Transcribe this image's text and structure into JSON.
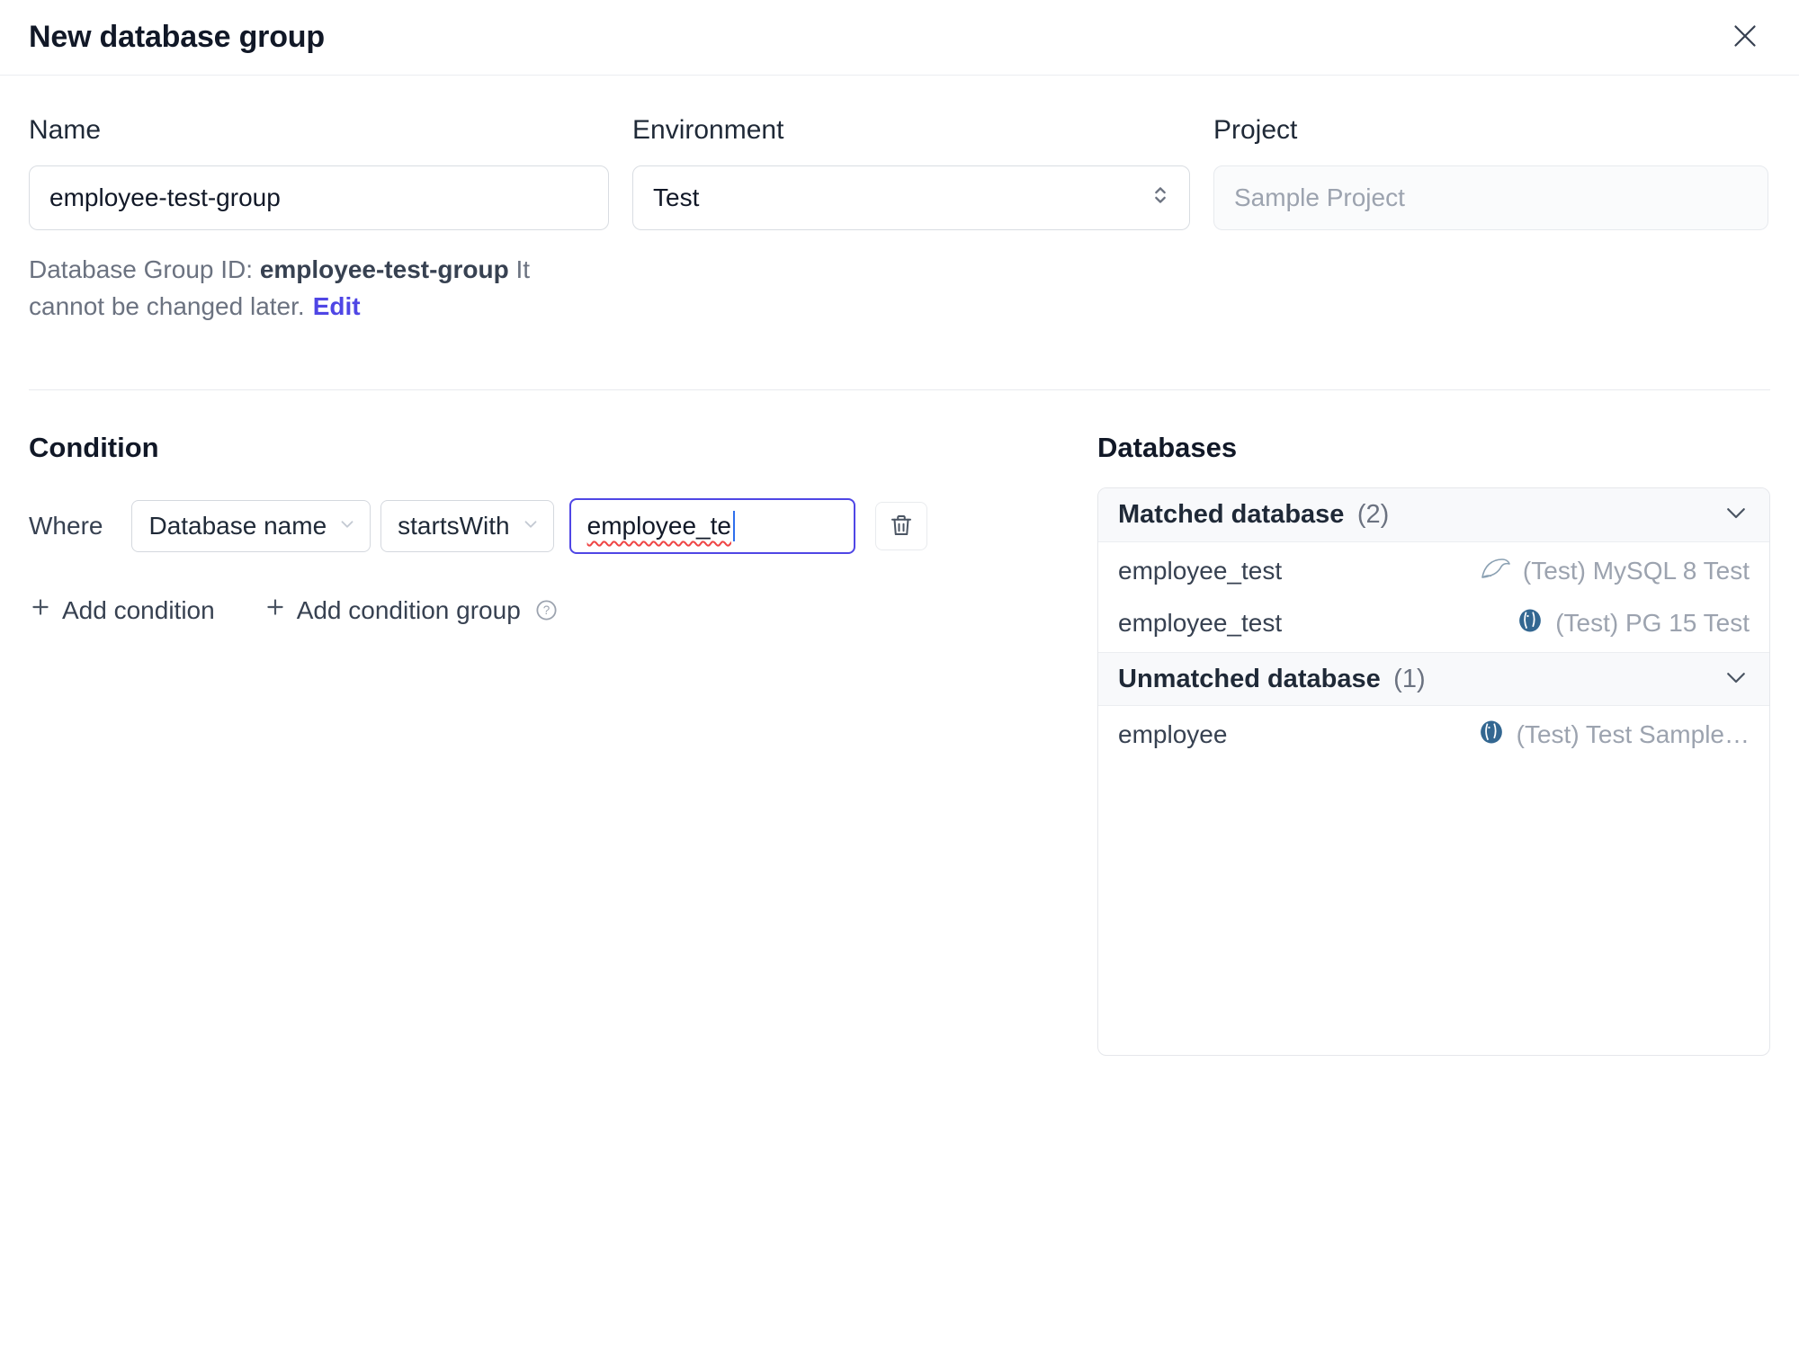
{
  "colors": {
    "accent": "#4f46e5",
    "link": "#4f46e5",
    "text": "#1f2937",
    "muted": "#6b7280",
    "faint": "#9ca3af",
    "border": "#e5e7eb",
    "spellcheck_red": "#ef4444",
    "postgres_blue": "#336791",
    "mysql_gray": "#8aa0b2"
  },
  "header": {
    "title": "New database group"
  },
  "form": {
    "name": {
      "label": "Name",
      "value": "employee-test-group"
    },
    "environment": {
      "label": "Environment",
      "value": "Test"
    },
    "project": {
      "label": "Project",
      "value": "Sample Project"
    },
    "group_id_note": {
      "prefix": "Database Group ID: ",
      "id": "employee-test-group",
      "suffix": " It cannot be changed later.",
      "edit_link": "Edit"
    }
  },
  "condition": {
    "heading": "Condition",
    "where_label": "Where",
    "field": "Database name",
    "operator": "startsWith",
    "value": "employee_te",
    "add_condition": "Add condition",
    "add_condition_group": "Add condition group"
  },
  "databases": {
    "heading": "Databases",
    "groups": [
      {
        "label": "Matched database",
        "count": "(2)",
        "rows": [
          {
            "name": "employee_test",
            "engine": "mysql",
            "instance": "(Test) MySQL 8 Test"
          },
          {
            "name": "employee_test",
            "engine": "postgres",
            "instance": "(Test) PG 15 Test"
          }
        ]
      },
      {
        "label": "Unmatched database",
        "count": "(1)",
        "rows": [
          {
            "name": "employee",
            "engine": "postgres",
            "instance": "(Test) Test Sample…"
          }
        ]
      }
    ]
  }
}
